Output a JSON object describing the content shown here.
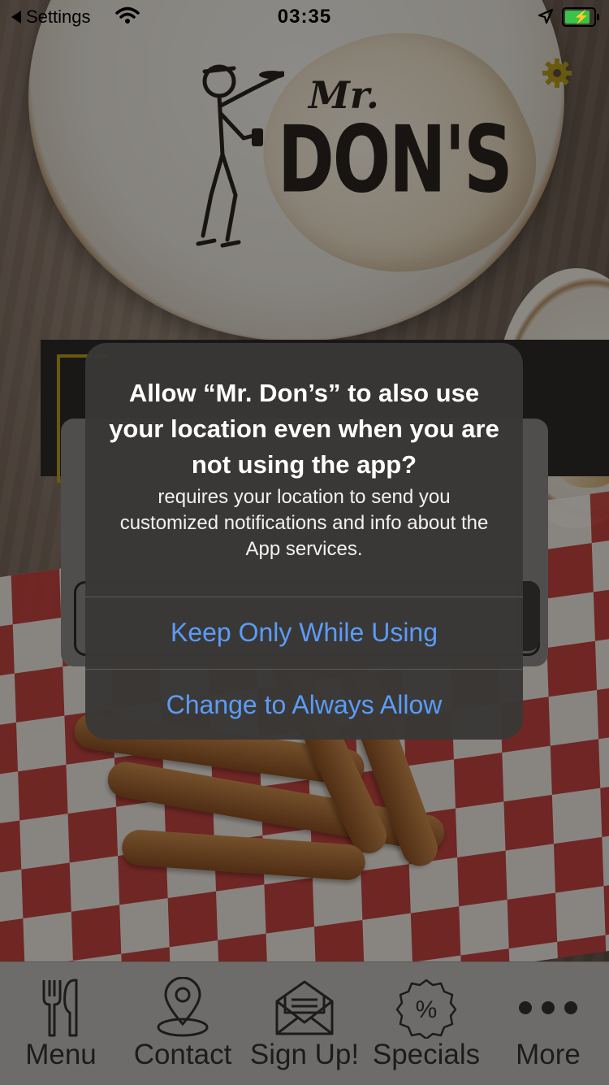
{
  "status_bar": {
    "back_label": "Settings",
    "time": "03:35"
  },
  "logo": {
    "brand_line1": "Mr.",
    "brand_line2": "DON'S"
  },
  "alert": {
    "title": "Allow “Mr. Don’s” to also use your location even when you are not using the app?",
    "message": "requires your location to send you customized notifications and info about the App services.",
    "primary_button": "Keep Only While Using",
    "secondary_button": "Change to Always Allow",
    "button_color": "#5a9cf8"
  },
  "tabbar": {
    "items": [
      {
        "label": "Menu",
        "icon": "fork-knife-icon"
      },
      {
        "label": "Contact",
        "icon": "location-pin-icon"
      },
      {
        "label": "Sign Up!",
        "icon": "envelope-icon"
      },
      {
        "label": "Specials",
        "icon": "percent-badge-icon"
      },
      {
        "label": "More",
        "icon": "more-dots-icon"
      }
    ]
  },
  "colors": {
    "battery_green": "#39c348",
    "accent_yellow": "#b59a1a"
  }
}
